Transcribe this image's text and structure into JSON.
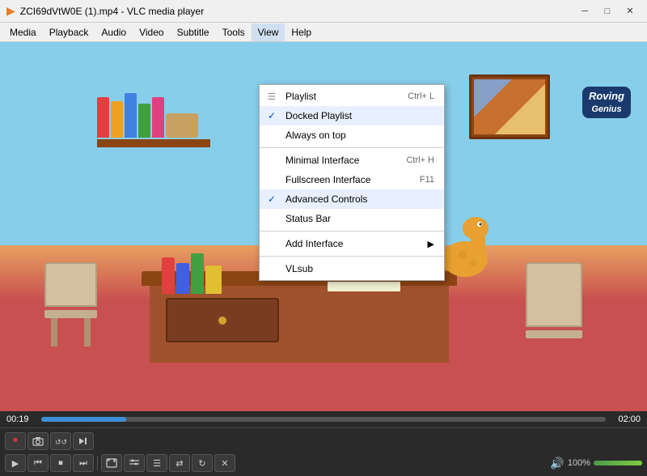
{
  "titleBar": {
    "title": "ZCI69dVtW0E (1).mp4 - VLC media player",
    "icon": "▶",
    "minimize": "─",
    "maximize": "□",
    "close": "✕"
  },
  "menuBar": {
    "items": [
      {
        "id": "media",
        "label": "Media"
      },
      {
        "id": "playback",
        "label": "Playback"
      },
      {
        "id": "audio",
        "label": "Audio"
      },
      {
        "id": "video",
        "label": "Video"
      },
      {
        "id": "subtitle",
        "label": "Subtitle"
      },
      {
        "id": "tools",
        "label": "Tools"
      },
      {
        "id": "view",
        "label": "View"
      },
      {
        "id": "help",
        "label": "Help"
      }
    ]
  },
  "viewMenu": {
    "items": [
      {
        "id": "playlist",
        "label": "Playlist",
        "shortcut": "Ctrl+ L",
        "check": "",
        "hasSubmenu": false
      },
      {
        "id": "docked-playlist",
        "label": "Docked Playlist",
        "shortcut": "",
        "check": "✓",
        "hasSubmenu": false,
        "checked": true
      },
      {
        "id": "always-on-top",
        "label": "Always on top",
        "shortcut": "",
        "check": "",
        "hasSubmenu": false
      },
      {
        "id": "sep1",
        "separator": true
      },
      {
        "id": "minimal-interface",
        "label": "Minimal Interface",
        "shortcut": "Ctrl+ H",
        "check": "",
        "hasSubmenu": false
      },
      {
        "id": "fullscreen-interface",
        "label": "Fullscreen Interface",
        "shortcut": "F11",
        "check": "",
        "hasSubmenu": false
      },
      {
        "id": "advanced-controls",
        "label": "Advanced Controls",
        "shortcut": "",
        "check": "✓",
        "hasSubmenu": false,
        "checked": true
      },
      {
        "id": "status-bar",
        "label": "Status Bar",
        "shortcut": "",
        "check": "",
        "hasSubmenu": false
      },
      {
        "id": "sep2",
        "separator": true
      },
      {
        "id": "add-interface",
        "label": "Add Interface",
        "shortcut": "",
        "check": "",
        "hasSubmenu": true
      },
      {
        "id": "sep3",
        "separator": true
      },
      {
        "id": "vlsub",
        "label": "VLsub",
        "shortcut": "",
        "check": "",
        "hasSubmenu": false
      }
    ]
  },
  "logo": {
    "line1": "Roving",
    "line2": "Genius"
  },
  "player": {
    "timeElapsed": "00:19",
    "timeTotal": "02:00",
    "progressPercent": 15,
    "volumePercent": 100
  },
  "advancedControls": {
    "buttons": [
      {
        "id": "record",
        "icon": "⏺",
        "label": "Record"
      },
      {
        "id": "snapshot",
        "icon": "📷",
        "label": "Snapshot"
      },
      {
        "id": "loop",
        "icon": "↺↺",
        "label": "Loop"
      },
      {
        "id": "frame",
        "icon": "▶|",
        "label": "Frame by frame"
      }
    ]
  },
  "controls": {
    "mainButtons": [
      {
        "id": "play",
        "icon": "▶",
        "label": "Play"
      },
      {
        "id": "prev",
        "icon": "⏮",
        "label": "Previous"
      },
      {
        "id": "stop",
        "icon": "⏹",
        "label": "Stop"
      },
      {
        "id": "next",
        "icon": "⏭",
        "label": "Next"
      },
      {
        "id": "fullscreen",
        "icon": "⛶",
        "label": "Fullscreen"
      },
      {
        "id": "extended",
        "icon": "⚙",
        "label": "Extended settings"
      },
      {
        "id": "playlist-btn",
        "icon": "☰",
        "label": "Playlist"
      },
      {
        "id": "random",
        "icon": "⇄",
        "label": "Random"
      },
      {
        "id": "loop-btn",
        "icon": "↻",
        "label": "Loop"
      },
      {
        "id": "more",
        "icon": "✕",
        "label": "More"
      }
    ],
    "volumeLabel": "100%"
  }
}
